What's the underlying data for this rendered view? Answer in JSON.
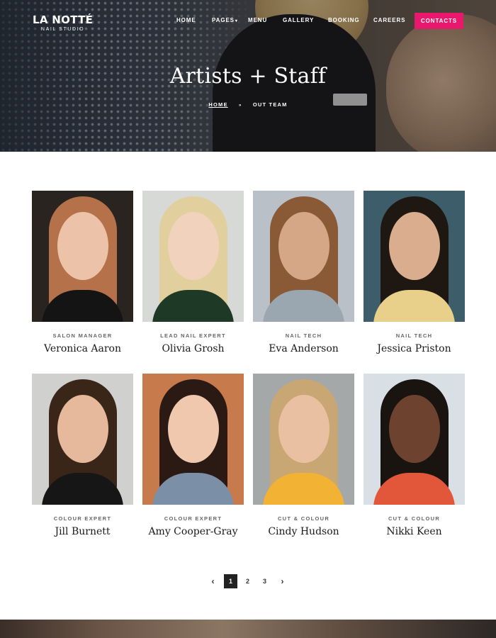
{
  "brand": {
    "name": "LA NOTTÉ",
    "tagline": "NAIL STUDIO"
  },
  "nav": {
    "items": [
      {
        "label": "HOME",
        "has_caret": false
      },
      {
        "label": "PAGES",
        "has_caret": true
      },
      {
        "label": "MENU",
        "has_caret": false
      },
      {
        "label": "GALLERY",
        "has_caret": false
      },
      {
        "label": "BOOKING",
        "has_caret": false
      },
      {
        "label": "CAREERS",
        "has_caret": false
      }
    ],
    "cta_label": "CONTACTS"
  },
  "hero": {
    "title": "Artists + Staff",
    "breadcrumb": {
      "home": "HOME",
      "separator": "»",
      "current": "OUT TEAM"
    }
  },
  "team": [
    {
      "role": "SALON MANAGER",
      "name": "Veronica Aaron"
    },
    {
      "role": "LEAD NAIL EXPERT",
      "name": "Olivia Grosh"
    },
    {
      "role": "NAIL TECH",
      "name": "Eva Anderson"
    },
    {
      "role": "NAIL TECH",
      "name": "Jessica Priston"
    },
    {
      "role": "COLOUR EXPERT",
      "name": "Jill Burnett"
    },
    {
      "role": "COLOUR EXPERT",
      "name": "Amy Cooper-Gray"
    },
    {
      "role": "CUT & COLOUR",
      "name": "Cindy Hudson"
    },
    {
      "role": "CUT & COLOUR",
      "name": "Nikki Keen"
    }
  ],
  "pagination": {
    "prev_icon": "‹",
    "pages": [
      "1",
      "2",
      "3"
    ],
    "current": "1",
    "next_icon": "›"
  },
  "colors": {
    "accent": "#e8196c",
    "active_page": "#222222"
  }
}
